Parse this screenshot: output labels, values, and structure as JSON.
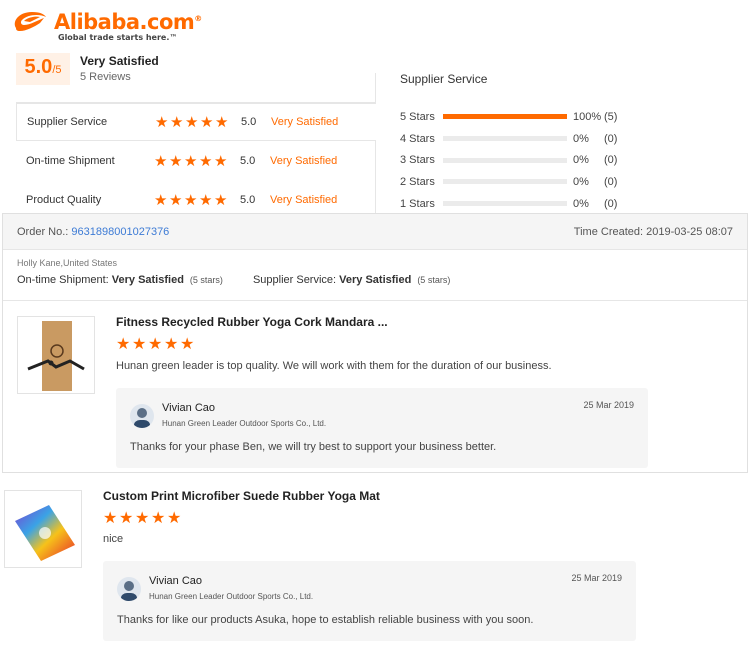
{
  "brand": {
    "name": "Alibaba.com",
    "registered": "®",
    "tagline": "Global trade starts here.™",
    "accent": "#ff6a00"
  },
  "summary": {
    "score": "5.0",
    "score_suffix": "/5",
    "satisfaction": "Very Satisfied",
    "reviews": "5 Reviews"
  },
  "ratings": [
    {
      "label": "Supplier Service",
      "stars": 5,
      "value": "5.0",
      "desc": "Very Satisfied"
    },
    {
      "label": "On-time Shipment",
      "stars": 5,
      "value": "5.0",
      "desc": "Very Satisfied"
    },
    {
      "label": "Product Quality",
      "stars": 5,
      "value": "5.0",
      "desc": "Very Satisfied"
    }
  ],
  "distribution": {
    "title": "Supplier Service",
    "rows": [
      {
        "label": "5 Stars",
        "fraction": 1.0,
        "pct": "100%",
        "count": "(5)"
      },
      {
        "label": "4 Stars",
        "fraction": 0.0,
        "pct": "0%",
        "count": "(0)"
      },
      {
        "label": "3 Stars",
        "fraction": 0.0,
        "pct": "0%",
        "count": "(0)"
      },
      {
        "label": "2 Stars",
        "fraction": 0.0,
        "pct": "0%",
        "count": "(0)"
      },
      {
        "label": "1 Stars",
        "fraction": 0.0,
        "pct": "0%",
        "count": "(0)"
      }
    ]
  },
  "order": {
    "label": "Order No.:",
    "number": "9631898001027376",
    "time_label": "Time Created:",
    "time": "2019-03-25 08:07",
    "buyer": "Holly Kane,United States",
    "shipment_label": "On-time Shipment:",
    "shipment_value": "Very Satisfied",
    "shipment_stars": "(5 stars)",
    "service_label": "Supplier Service:",
    "service_value": "Very Satisfied",
    "service_stars": "(5 stars)"
  },
  "reviews": [
    {
      "product": "Fitness Recycled Rubber Yoga Cork Mandara ...",
      "stars": 5,
      "text": "Hunan green leader is top quality. We will work with them for the duration of our business.",
      "reply": {
        "name": "Vivian Cao",
        "company": "Hunan Green Leader Outdoor Sports Co., Ltd.",
        "date": "25 Mar 2019",
        "text": "Thanks for your phase Ben, we will try best to support your business better."
      }
    },
    {
      "product": "Custom Print Microfiber Suede Rubber Yoga Mat",
      "stars": 5,
      "text": "nice",
      "reply": {
        "name": "Vivian Cao",
        "company": "Hunan Green Leader Outdoor Sports Co., Ltd.",
        "date": "25 Mar 2019",
        "text": "Thanks for like our products Asuka, hope to establish reliable business with you soon."
      }
    }
  ]
}
